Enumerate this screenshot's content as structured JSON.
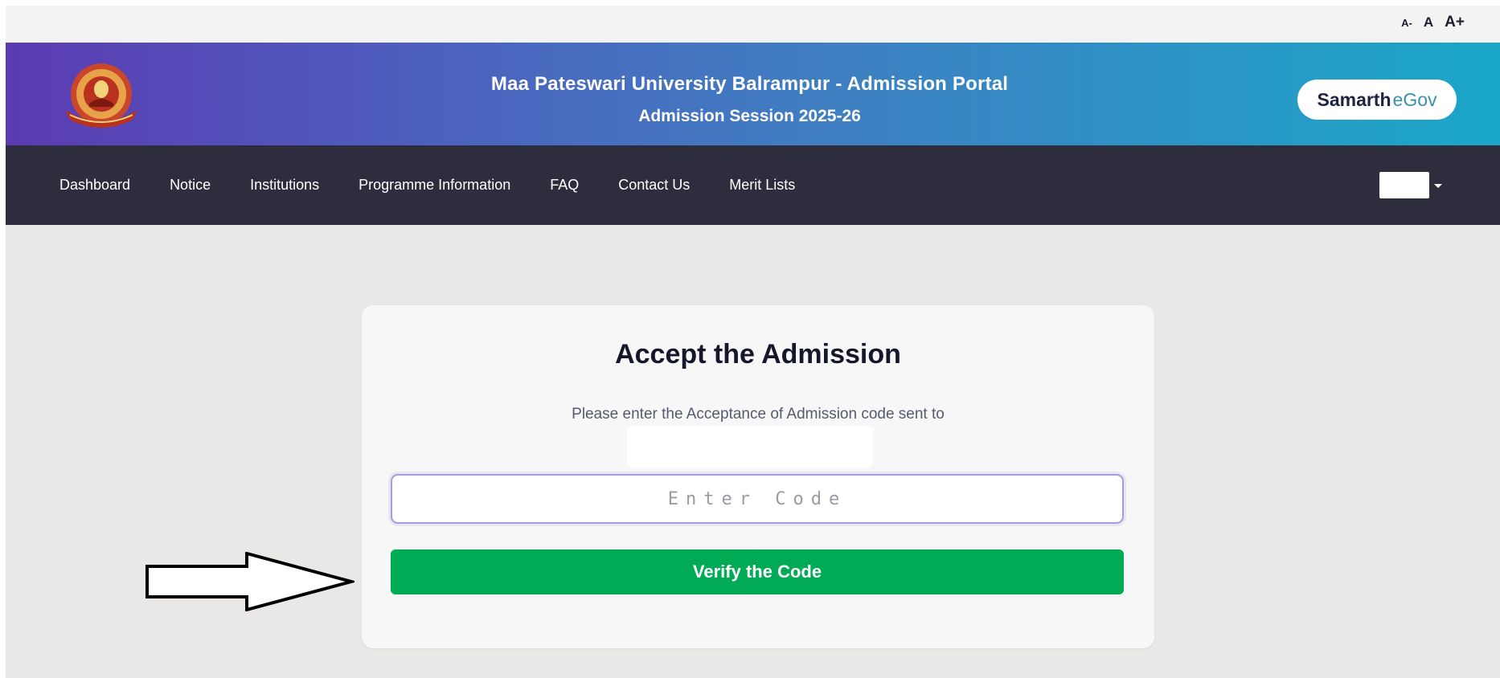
{
  "accessibility": {
    "font_decrease": "A-",
    "font_normal": "A",
    "font_increase": "A+"
  },
  "header": {
    "title": "Maa Pateswari University Balrampur - Admission Portal",
    "subtitle": "Admission Session 2025-26",
    "logo_icon": "university-seal-icon",
    "brand_part1": "Samarth",
    "brand_part2": "eGov"
  },
  "nav": {
    "items": [
      {
        "label": "Dashboard"
      },
      {
        "label": "Notice"
      },
      {
        "label": "Institutions"
      },
      {
        "label": "Programme Information"
      },
      {
        "label": "FAQ"
      },
      {
        "label": "Contact Us"
      },
      {
        "label": "Merit Lists"
      }
    ],
    "language_selector": ""
  },
  "card": {
    "title": "Accept the Admission",
    "description": "Please enter the Acceptance of Admission code sent to",
    "code_input": {
      "value": "",
      "placeholder": "Enter Code"
    },
    "verify_button_label": "Verify the Code"
  },
  "colors": {
    "header_gradient_start": "#5b3bb2",
    "header_gradient_end": "#1aa7c8",
    "navbar": "#2e2d3d",
    "verify_button": "#01aa55",
    "page_background": "#e9e8e7"
  }
}
